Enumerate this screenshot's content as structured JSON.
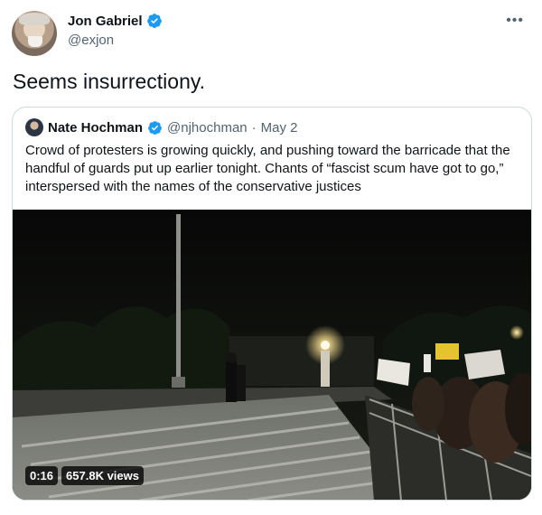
{
  "tweet": {
    "author": {
      "display_name": "Jon Gabriel",
      "handle": "@exjon",
      "verified": true
    },
    "text": "Seems insurrectiony.",
    "more_icon": "more-icon",
    "quoted": {
      "author": {
        "display_name": "Nate Hochman",
        "handle": "@njhochman",
        "separator": "·",
        "date": "May 2",
        "verified": true
      },
      "text": "Crowd of protesters is growing quickly, and pushing toward the barricade that the handful of guards put up earlier tonight. Chants of “fascist scum have got to go,” interspersed with the names of the conservative justices",
      "video": {
        "duration": "0:16",
        "views": "657.8K views"
      }
    }
  },
  "colors": {
    "verified": "#1d9bf0",
    "secondary_text": "#536471",
    "border": "#cfd9de"
  }
}
